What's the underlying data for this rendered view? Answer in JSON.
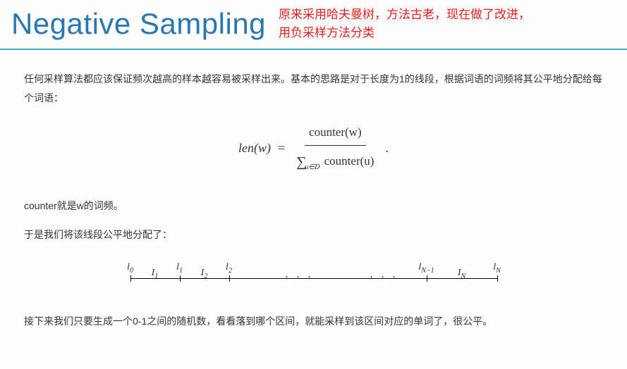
{
  "header": {
    "title": "Negative Sampling",
    "annotation_line1": "原来采用哈夫曼树，方法古老，现在做了改进，",
    "annotation_line2": "用负采样方法分类"
  },
  "body": {
    "para1": "任何采样算法都应该保证频次越高的样本越容易被采样出来。基本的思路是对于长度为1的线段，根据词语的词频将其公平地分配给每个词语：",
    "formula": {
      "lhs": "len(w)",
      "eq": "=",
      "numerator": "counter(w)",
      "denominator_sum_sub": "u∈D",
      "denominator_term": "counter(u)",
      "trailing_dot": "."
    },
    "para2": "counter就是w的词频。",
    "para3": "于是我们将该线段公平地分配了：",
    "segment": {
      "l0": "l",
      "l0_sub": "0",
      "I1": "I",
      "I1_sub": "1",
      "l1": "l",
      "l1_sub": "1",
      "I2": "I",
      "I2_sub": "2",
      "l2": "l",
      "l2_sub": "2",
      "dots": ". . .",
      "lNm1": "l",
      "lNm1_sub": "N−1",
      "IN": "I",
      "IN_sub": "N",
      "lN": "l",
      "lN_sub": "N"
    },
    "para4": "接下来我们只要生成一个0-1之间的随机数，看看落到哪个区间，就能采样到该区间对应的单词了，很公平。"
  }
}
